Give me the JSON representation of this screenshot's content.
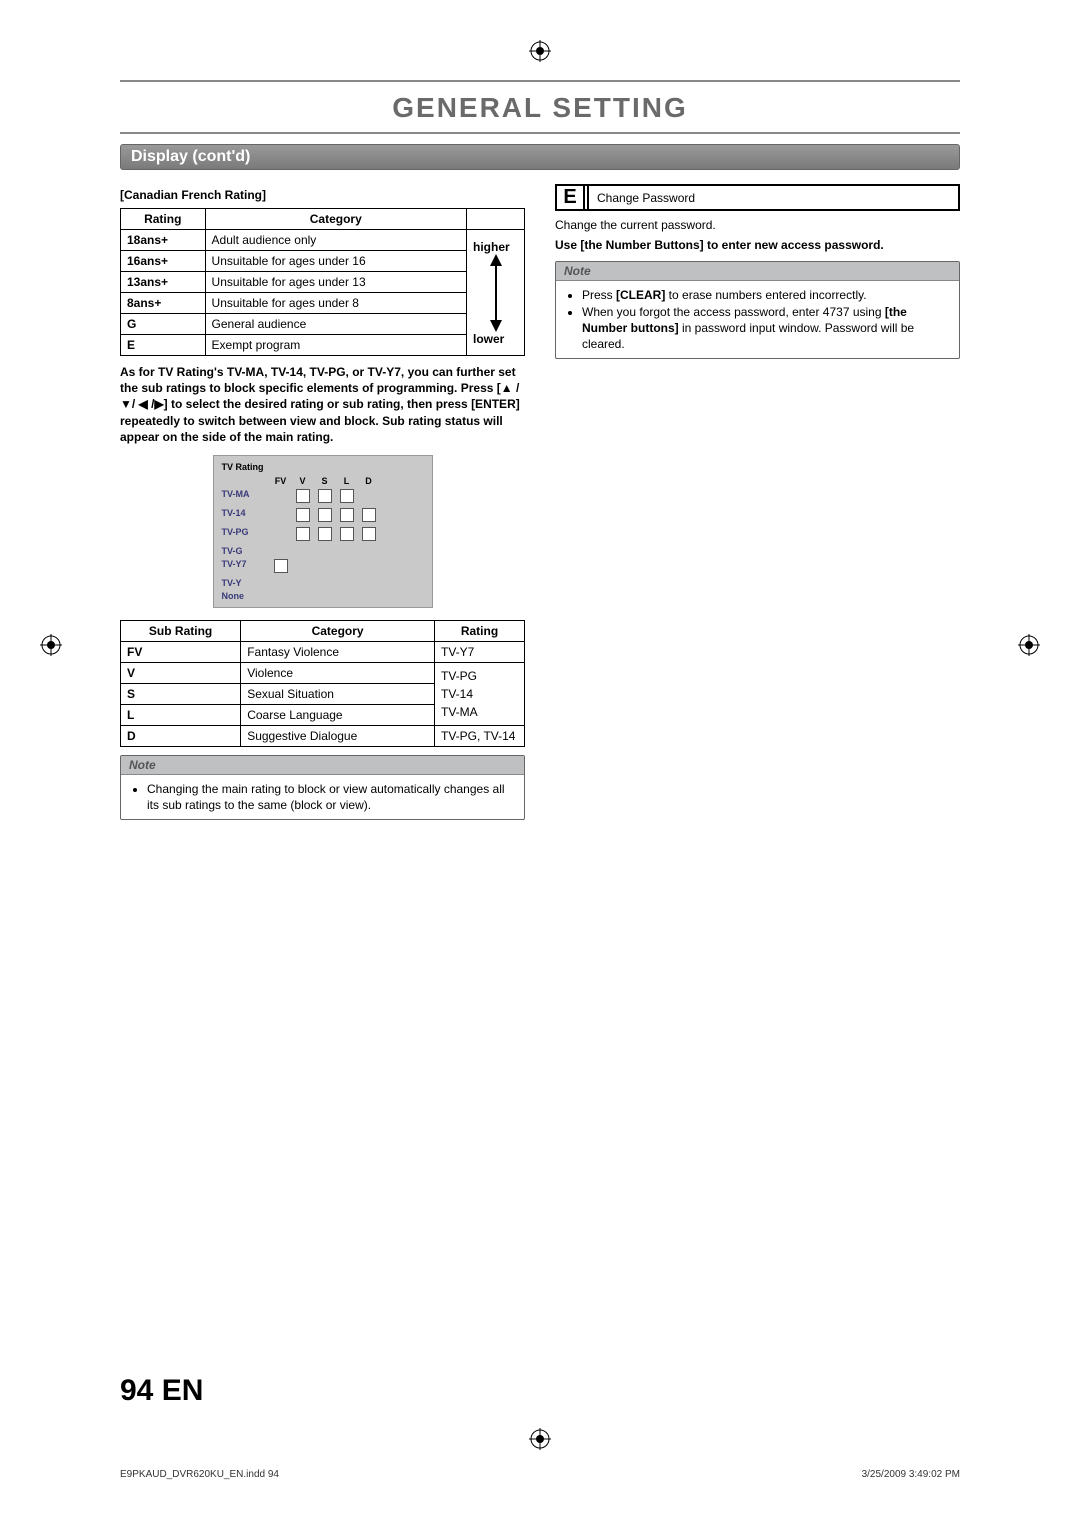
{
  "title": "GENERAL SETTING",
  "section_bar": "Display (cont'd)",
  "left": {
    "subhead": "[Canadian French Rating]",
    "table1": {
      "headers": [
        "Rating",
        "Category",
        ""
      ],
      "rows": [
        {
          "rating": "18ans+",
          "category": "Adult audience only"
        },
        {
          "rating": "16ans+",
          "category": "Unsuitable for ages under 16"
        },
        {
          "rating": "13ans+",
          "category": "Unsuitable for ages under 13"
        },
        {
          "rating": "8ans+",
          "category": "Unsuitable for ages under 8"
        },
        {
          "rating": "G",
          "category": "General audience"
        },
        {
          "rating": "E",
          "category": "Exempt program"
        }
      ],
      "arrow_top": "higher",
      "arrow_bottom": "lower"
    },
    "bold_para": "As for TV Rating's TV-MA, TV-14, TV-PG, or TV-Y7, you can further set the sub ratings to block specific elements of programming. Press [▲ /▼/  ◀ /▶] to select the desired rating or sub rating, then press [ENTER] repeatedly to switch between view and block. Sub rating status will appear on the side of the main rating.",
    "tvbox": {
      "title": "TV Rating",
      "cols": [
        "FV",
        "V",
        "S",
        "L",
        "D"
      ],
      "rows": [
        "TV-MA",
        "TV-14",
        "TV-PG",
        "TV-G",
        "TV-Y7",
        "TV-Y",
        "None"
      ]
    },
    "table2": {
      "headers": [
        "Sub Rating",
        "Category",
        "Rating"
      ],
      "rows": [
        {
          "sub": "FV",
          "cat": "Fantasy Violence",
          "rating": "TV-Y7"
        },
        {
          "sub": "V",
          "cat": "Violence",
          "rating": "TV-PG"
        },
        {
          "sub": "S",
          "cat": "Sexual Situation",
          "rating": "TV-14"
        },
        {
          "sub": "L",
          "cat": "Coarse Language",
          "rating": "TV-MA"
        },
        {
          "sub": "D",
          "cat": "Suggestive Dialogue",
          "rating": "TV-PG, TV-14"
        }
      ]
    },
    "note": {
      "title": "Note",
      "item": "Changing the main rating to block or view automatically changes all its sub ratings to the same (block or view)."
    }
  },
  "right": {
    "e_label": "E",
    "e_text": "Change Password",
    "p1": "Change the current password.",
    "p2": "Use [the Number Buttons] to enter new access password.",
    "note": {
      "title": "Note",
      "items": [
        {
          "pre": "Press ",
          "bold": "[CLEAR]",
          "post": " to erase numbers entered incorrectly."
        },
        {
          "pre": "When you forgot the access password, enter 4737 using ",
          "bold": "[the Number buttons]",
          "post": " in password input window. Password will be cleared."
        }
      ]
    }
  },
  "footer": {
    "page_num": "94",
    "lang": "EN",
    "file": "E9PKAUD_DVR620KU_EN.indd   94",
    "timestamp": "3/25/2009   3:49:02 PM"
  },
  "reg_mark": "⊕"
}
